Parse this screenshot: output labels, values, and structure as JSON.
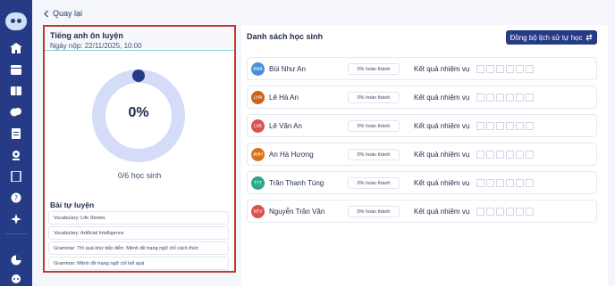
{
  "nav": {
    "icons": [
      "home-icon",
      "calendar-icon",
      "book-icon",
      "chat-icon",
      "assignment-icon",
      "location-icon",
      "document-icon",
      "help-icon",
      "sparkle-icon",
      "pie-chart-icon",
      "robot-icon"
    ]
  },
  "back_label": "Quay lại",
  "assignment": {
    "title": "Tiếng anh ôn luyện",
    "date": "Ngày nộp: 22/11/2025, 10:00",
    "progress_percent": 0,
    "progress_label": "0%",
    "student_count": "0/6 học sinh",
    "exercises_title": "Bài tự luyện",
    "exercises": [
      "Vocabulary: Life Stories",
      "Vocabulary: Artificial Intelligence",
      "Grammar: Thì quá khứ tiếp diễn: Mệnh đề trạng ngữ chỉ cách thức",
      "Grammar: Mệnh đề trạng ngữ chỉ kết quả"
    ]
  },
  "students_panel": {
    "title": "Danh sách học sinh",
    "sync_label": "Đồng bộ lịch sử tự học",
    "students": [
      {
        "initials": "BNA",
        "name": "Bùi Như An",
        "done": "0% hoàn thành",
        "result_label": "Kết quả nhiệm vụ",
        "color": "#4a90d9"
      },
      {
        "initials": "LHA",
        "name": "Lê Hà An",
        "done": "0% hoàn thành",
        "result_label": "Kết quả nhiệm vụ",
        "color": "#c9651a"
      },
      {
        "initials": "LVA",
        "name": "Lê Văn An",
        "done": "0% hoàn thành",
        "result_label": "Kết quả nhiệm vụ",
        "color": "#d9534f"
      },
      {
        "initials": "AHH",
        "name": "An Hà Hương",
        "done": "0% hoàn thành",
        "result_label": "Kết quả nhiệm vụ",
        "color": "#d9731a"
      },
      {
        "initials": "TTT",
        "name": "Trần Thanh Tùng",
        "done": "0% hoàn thành",
        "result_label": "Kết quả nhiệm vụ",
        "color": "#2aa889"
      },
      {
        "initials": "NTV",
        "name": "Nguyễn Trần Văn",
        "done": "0% hoàn thành",
        "result_label": "Kết quả nhiệm vụ",
        "color": "#d9534f"
      }
    ]
  }
}
